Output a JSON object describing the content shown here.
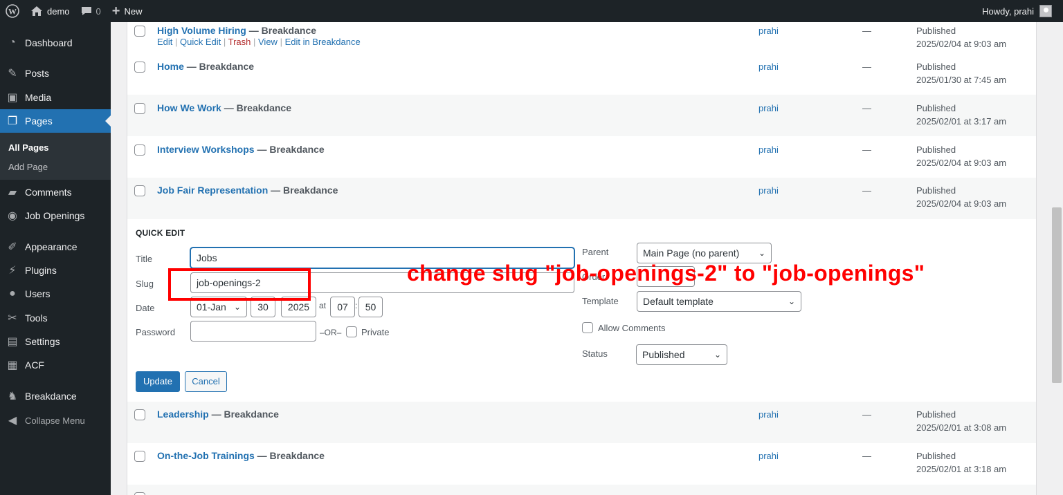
{
  "adminbar": {
    "site_name": "demo",
    "comments_count": "0",
    "new_label": "New",
    "howdy": "Howdy, prahi"
  },
  "sidebar": {
    "items": [
      {
        "label": "Dashboard",
        "icon": "dashboard-icon"
      },
      {
        "label": "Posts",
        "icon": "pin-icon"
      },
      {
        "label": "Media",
        "icon": "media-icon"
      },
      {
        "label": "Pages",
        "icon": "pages-icon",
        "current": true
      },
      {
        "label": "Comments",
        "icon": "comment-icon"
      },
      {
        "label": "Job Openings",
        "icon": "job-openings-icon"
      },
      {
        "label": "Appearance",
        "icon": "brush-icon"
      },
      {
        "label": "Plugins",
        "icon": "plugin-icon"
      },
      {
        "label": "Users",
        "icon": "user-icon"
      },
      {
        "label": "Tools",
        "icon": "wrench-icon"
      },
      {
        "label": "Settings",
        "icon": "settings-icon"
      },
      {
        "label": "ACF",
        "icon": "acf-icon"
      },
      {
        "label": "Breakdance",
        "icon": "breakdance-icon"
      }
    ],
    "submenu": {
      "all_pages": "All Pages",
      "add_page": "Add Page"
    },
    "collapse": "Collapse Menu"
  },
  "rows_top": [
    {
      "title": "High Volume Hiring",
      "state": " — Breakdance",
      "author": "prahi",
      "dash": "—",
      "status": "Published",
      "date": "2025/02/04 at 9:03 am"
    },
    {
      "title": "Home",
      "state": " — Breakdance",
      "author": "prahi",
      "dash": "—",
      "status": "Published",
      "date": "2025/01/30 at 7:45 am"
    },
    {
      "title": "How We Work",
      "state": " — Breakdance",
      "author": "prahi",
      "dash": "—",
      "status": "Published",
      "date": "2025/02/01 at 3:17 am"
    },
    {
      "title": "Interview Workshops",
      "state": " — Breakdance",
      "author": "prahi",
      "dash": "—",
      "status": "Published",
      "date": "2025/02/04 at 9:03 am"
    },
    {
      "title": "Job Fair Representation",
      "state": " — Breakdance",
      "author": "prahi",
      "dash": "—",
      "status": "Published",
      "date": "2025/02/04 at 9:03 am"
    }
  ],
  "row_actions": {
    "edit": "Edit",
    "quick_edit": "Quick Edit",
    "trash": "Trash",
    "view": "View",
    "edit_breakdance": "Edit in Breakdance",
    "sep": " | "
  },
  "quick_edit": {
    "heading": "QUICK EDIT",
    "title_label": "Title",
    "title_value": "Jobs",
    "slug_label": "Slug",
    "slug_value": "job-openings-2",
    "date_label": "Date",
    "month": "01-Jan",
    "day": "30",
    "year": "2025",
    "at": "at",
    "hour": "07",
    "colon": ":",
    "minute": "50",
    "password_label": "Password",
    "or": "–OR–",
    "private_label": "Private",
    "parent_label": "Parent",
    "parent_value": "Main Page (no parent)",
    "order_label": "Order",
    "template_label": "Template",
    "template_value": "Default template",
    "allow_comments": "Allow Comments",
    "status_label": "Status",
    "status_value": "Published",
    "update": "Update",
    "cancel": "Cancel"
  },
  "rows_bottom": [
    {
      "title": "Leadership",
      "state": " — Breakdance",
      "author": "prahi",
      "dash": "—",
      "status": "Published",
      "date": "2025/02/01 at 3:08 am"
    },
    {
      "title": "On-the-Job Trainings",
      "state": " — Breakdance",
      "author": "prahi",
      "dash": "—",
      "status": "Published",
      "date": "2025/02/01 at 3:18 am"
    }
  ],
  "annotation": {
    "text": "change slug \"job-openings-2\" to \"job-openings\"",
    "color": "#ff0000"
  },
  "colors": {
    "link": "#2271b1",
    "sidebar": "#1d2327",
    "current": "#2271b1"
  }
}
